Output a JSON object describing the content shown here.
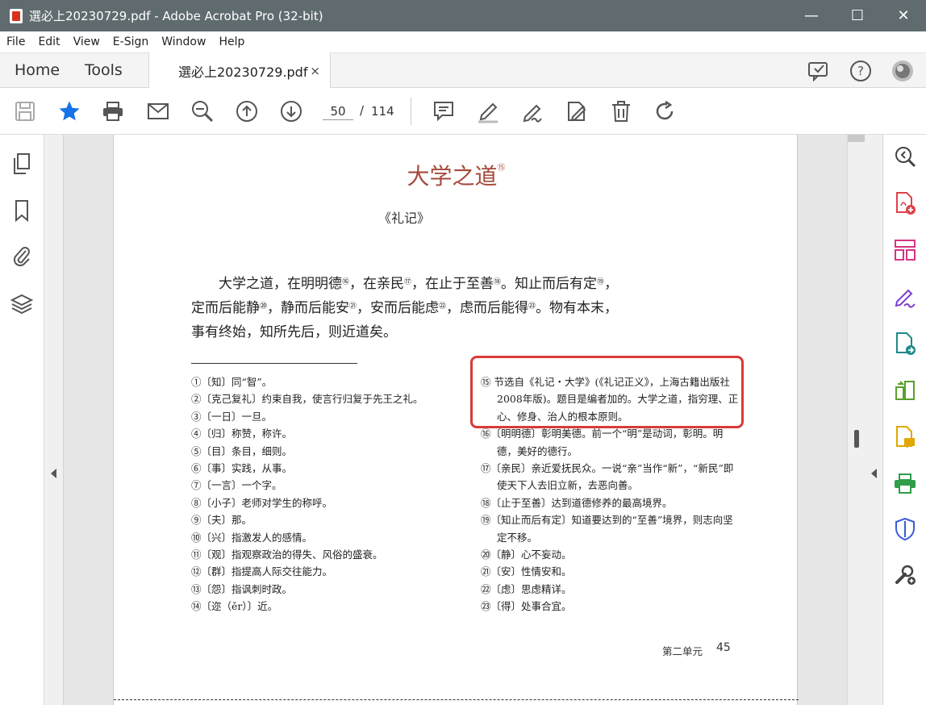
{
  "window": {
    "title": "選必上20230729.pdf - Adobe Acrobat Pro (32-bit)",
    "minimize": "—",
    "maximize": "☐",
    "close": "✕"
  },
  "menu": {
    "items": [
      "File",
      "Edit",
      "View",
      "E-Sign",
      "Window",
      "Help"
    ]
  },
  "tabs": {
    "home": "Home",
    "tools": "Tools",
    "doc_tab": "選必上20230729.pdf",
    "doc_tab_close": "×"
  },
  "toolbar": {
    "current_page": "50",
    "separator": "/",
    "total_pages": "114"
  },
  "document": {
    "title": "大学之道",
    "title_note": "⑮",
    "subtitle": "《礼记》",
    "body_lines": [
      [
        "大学之道，在明明德",
        "⑯",
        "，在亲民",
        "⑰",
        "，在止于至善",
        "⑱",
        "。知止而后有定",
        "⑲",
        "，"
      ],
      [
        "定而后能静",
        "⑳",
        "，静而后能安",
        "㉑",
        "，安而后能虑",
        "㉒",
        "，虑而后能得",
        "㉓",
        "。物有本末，"
      ],
      [
        "事有终始，知所先后，则近道矣。"
      ]
    ],
    "footnotes_left": [
      "①〔知〕同“智”。",
      "②〔克己复礼〕约束自我，使言行归复于先王之礼。",
      "③〔一日〕一旦。",
      "④〔归〕称赞，称许。",
      "⑤〔目〕条目，细则。",
      "⑥〔事〕实践，从事。",
      "⑦〔一言〕一个字。",
      "⑧〔小子〕老师对学生的称呼。",
      "⑨〔夫〕那。",
      "⑩〔兴〕指激发人的感情。",
      "⑪〔观〕指观察政治的得失、风俗的盛衰。",
      "⑫〔群〕指提高人际交往能力。",
      "⑬〔怨〕指讽刺时政。",
      "⑭〔迩（ěr）〕近。"
    ],
    "footnotes_right": [
      "⑮ 节选自《礼记・大学》(《礼记正义》，上海古籍出版社2008年版)。题目是编者加的。大学之道，指穷理、正心、修身、治人的根本原则。",
      "⑯〔明明德〕彰明美德。前一个“明”是动词，彰明。明德，美好的德行。",
      "⑰〔亲民〕亲近爱抚民众。一说“亲”当作“新”，“新民”即使天下人去旧立新，去恶向善。",
      "⑱〔止于至善〕达到道德修养的最高境界。",
      "⑲〔知止而后有定〕知道要达到的“至善”境界，则志向坚定不移。",
      "⑳〔静〕心不妄动。",
      "㉑〔安〕性情安和。",
      "㉒〔虑〕思虑精详。",
      "㉓〔得〕处事合宜。"
    ],
    "footer_label": "第二单元",
    "footer_page": "45"
  },
  "colors": {
    "titlebar": "#5f6b6f",
    "title_red": "#a54a3c",
    "highlight": "#d93a3a",
    "star_blue": "#1473e6"
  }
}
